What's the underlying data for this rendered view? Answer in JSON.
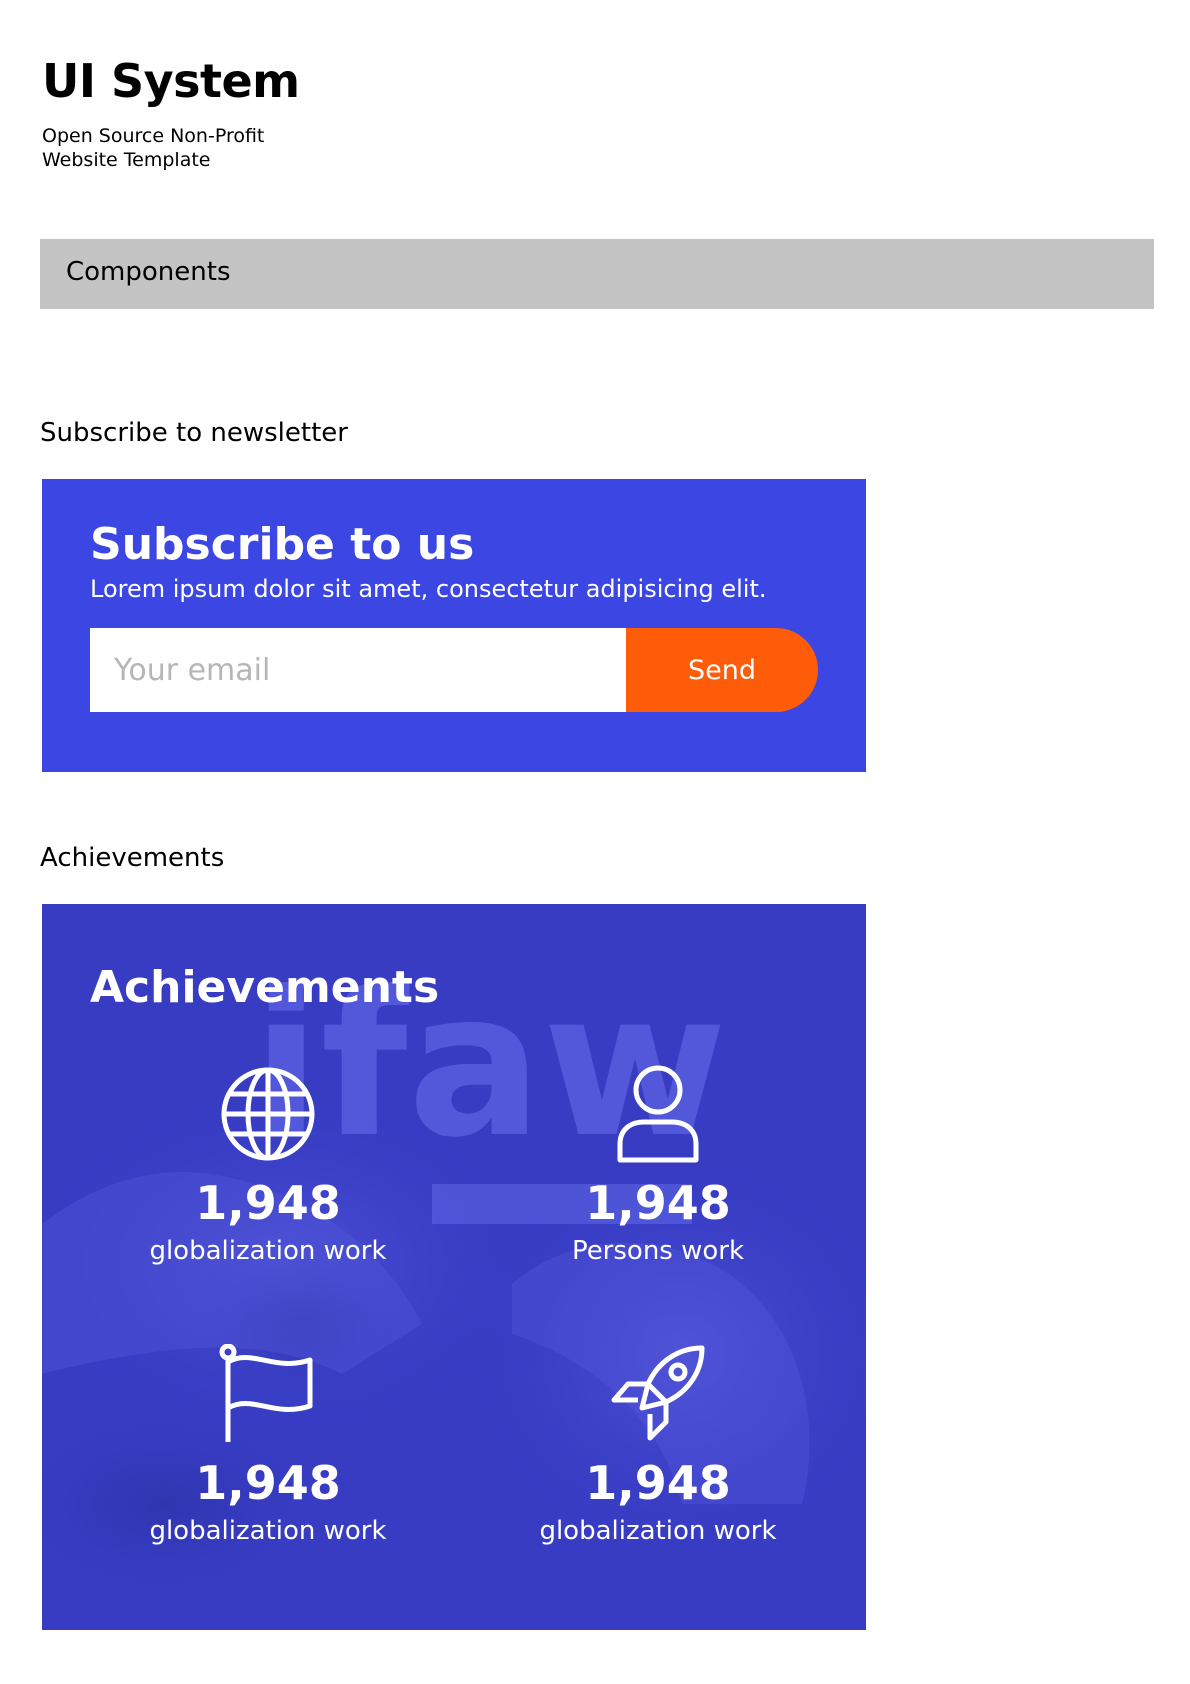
{
  "header": {
    "title": "UI System",
    "subtitle": "Open Source Non-Profit Website Template"
  },
  "section_bar": {
    "label": "Components"
  },
  "newsletter": {
    "section_label": "Subscribe to newsletter",
    "title": "Subscribe to us",
    "description": "Lorem ipsum dolor sit amet, consectetur adipisicing elit.",
    "email_placeholder": "Your email",
    "send_label": "Send",
    "colors": {
      "card": "#3c46e2",
      "button": "#ff5c0a"
    }
  },
  "achievements": {
    "section_label": "Achievements",
    "title": "Achievements",
    "background_logo_text": "ifaw",
    "stats": [
      {
        "icon": "globe-icon",
        "value": "1,948",
        "caption": "globalization work"
      },
      {
        "icon": "user-icon",
        "value": "1,948",
        "caption": "Persons work"
      },
      {
        "icon": "flag-icon",
        "value": "1,948",
        "caption": "globalization work"
      },
      {
        "icon": "rocket-icon",
        "value": "1,948",
        "caption": "globalization work"
      }
    ],
    "colors": {
      "overlay": "#3b41cc"
    }
  }
}
